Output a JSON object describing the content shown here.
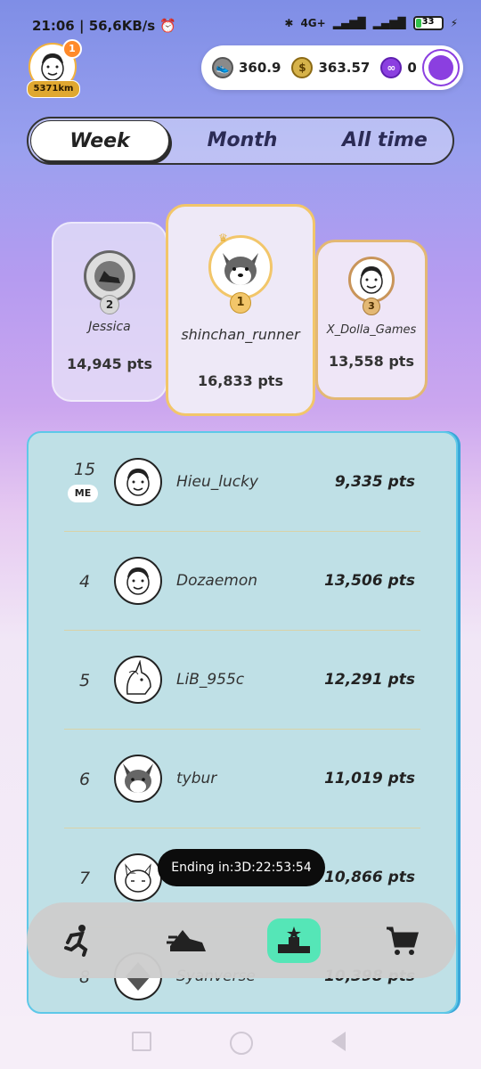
{
  "status": {
    "time": "21:06",
    "net": "56,6KB/s",
    "signal": "4G+",
    "battery": "33"
  },
  "user": {
    "badge": "1",
    "distance": "5371km"
  },
  "currency": [
    {
      "icon": "sneaker-coin-icon",
      "value": "360.9"
    },
    {
      "icon": "gst-coin-icon",
      "value": "363.57"
    },
    {
      "icon": "polygon-coin-icon",
      "value": "0"
    }
  ],
  "tabs": [
    "Week",
    "Month",
    "All time"
  ],
  "podium": [
    {
      "rank": "2",
      "name": "Jessica",
      "pts": "14,945 pts"
    },
    {
      "rank": "1",
      "name": "shinchan_runner",
      "pts": "16,833 pts"
    },
    {
      "rank": "3",
      "name": "X_Dolla_Games",
      "pts": "13,558 pts"
    }
  ],
  "me_tag": "ME",
  "rows": [
    {
      "rank": "15",
      "name": "Hieu_lucky",
      "pts": "9,335 pts"
    },
    {
      "rank": "4",
      "name": "Dozaemon",
      "pts": "13,506 pts"
    },
    {
      "rank": "5",
      "name": "LiB_955c",
      "pts": "12,291 pts"
    },
    {
      "rank": "6",
      "name": "tybur",
      "pts": "11,019 pts"
    },
    {
      "rank": "7",
      "name": "",
      "pts": "10,866 pts"
    },
    {
      "rank": "8",
      "name": "Syanverse",
      "pts": "10,398 pts"
    }
  ],
  "countdown": "Ending in:3D:22:53:54",
  "nav": [
    "run-icon",
    "sneaker-icon",
    "leaderboard-icon",
    "cart-icon"
  ],
  "colors": {
    "accent_gold": "#f2c66a",
    "panel_bg": "#bfe0e6",
    "nav_active": "#55e6b7",
    "polygon": "#8b3fe0"
  }
}
